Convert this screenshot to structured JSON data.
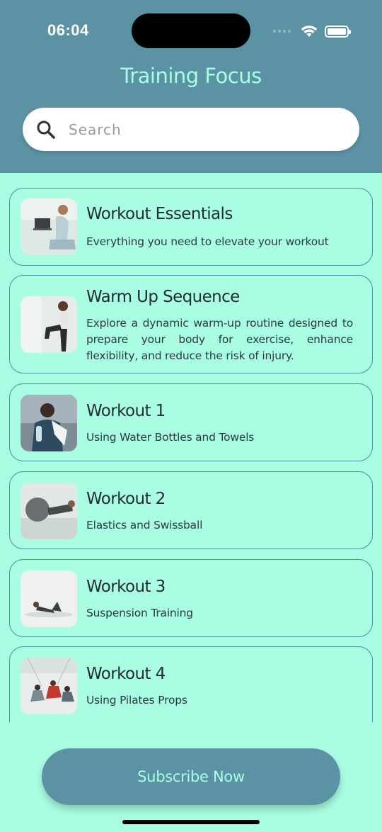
{
  "status_bar": {
    "time": "06:04"
  },
  "header": {
    "title": "Training Focus"
  },
  "search": {
    "placeholder": "Search",
    "value": ""
  },
  "cards": [
    {
      "title": "Workout Essentials",
      "description": "Everything you need to elevate your workout",
      "image": "person-with-laptop"
    },
    {
      "title": "Warm Up Sequence",
      "description": "Explore a dynamic warm-up routine designed to prepare your body for exercise, enhance flexibility, and reduce the risk of injury.",
      "image": "woman-stretching"
    },
    {
      "title": "Workout 1",
      "description": "Using Water Bottles and Towels",
      "image": "woman-with-towel"
    },
    {
      "title": "Workout 2",
      "description": "Elastics and Swissball",
      "image": "swiss-ball"
    },
    {
      "title": "Workout 3",
      "description": "Suspension Training",
      "image": "floor-exercise"
    },
    {
      "title": "Workout 4",
      "description": "Using Pilates Props",
      "image": "pilates-class"
    }
  ],
  "footer": {
    "subscribe_label": "Subscribe Now"
  },
  "colors": {
    "header": "#5b93a5",
    "background": "#a8fde3",
    "card_border": "#4f8ea2",
    "title_text": "#a8fde3"
  }
}
